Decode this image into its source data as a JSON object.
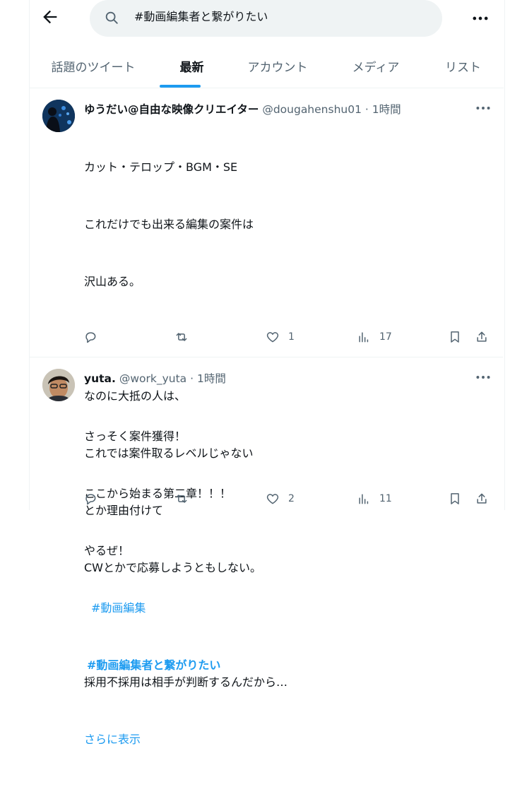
{
  "search": {
    "value": "#動画編集者と繋がりたい"
  },
  "tabs": [
    {
      "label": "話題のツイート"
    },
    {
      "label": "最新"
    },
    {
      "label": "アカウント"
    },
    {
      "label": "メディア"
    },
    {
      "label": "リスト"
    }
  ],
  "tweets": [
    {
      "name": "ゆうだい@自由な映像クリエイター",
      "handle": "@dougahenshu01",
      "time": "· 1時間",
      "lines": [
        "カット・テロップ・BGM・SE",
        "これだけでも出来る編集の案件は",
        "沢山ある。",
        "",
        "なのに大抵の人は、",
        "これでは案件取るレベルじゃない",
        "とか理由付けて",
        "CWとかで応募しようともしない。",
        "",
        "採用不採用は相手が判断するんだから…"
      ],
      "show_more": "さらに表示",
      "likes": "1",
      "views": "17"
    },
    {
      "name": "yuta.",
      "handle": "@work_yuta",
      "time": "· 1時間",
      "lines": [
        "さっそく案件獲得！",
        "ここから始まる第二章！！！",
        "やるぜ！"
      ],
      "tag1": "#動画編集",
      "tag2": "#動画編集者と繋がりたい",
      "likes": "2",
      "views": "11"
    }
  ],
  "icons": {
    "back": "arrow-left-icon",
    "search": "search-icon",
    "more": "more-horizontal-icon",
    "reply": "reply-icon",
    "retweet": "retweet-icon",
    "like": "heart-icon",
    "views": "views-icon",
    "bookmark": "bookmark-icon",
    "share": "share-icon"
  },
  "colors": {
    "accent": "#1d9bf0",
    "text": "#0f1419",
    "muted": "#536471",
    "border": "#eff3f4"
  }
}
